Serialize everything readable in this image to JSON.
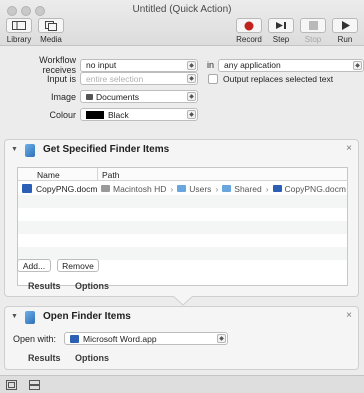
{
  "window": {
    "title": "Untitled (Quick Action)"
  },
  "toolbar": {
    "library_label": "Library",
    "media_label": "Media",
    "record_label": "Record",
    "step_label": "Step",
    "stop_label": "Stop",
    "run_label": "Run",
    "record_color": "#c0221c"
  },
  "workflow": {
    "receives_label": "Workflow receives",
    "receives_value": "no input",
    "in_label": "in",
    "in_value": "any application",
    "input_is_label": "Input is",
    "input_is_value": "entire selection",
    "replaces_label": "Output replaces selected text",
    "image_label": "Image",
    "image_value": "Documents",
    "colour_label": "Colour",
    "colour_value": "Black",
    "colour_swatch": "#000000"
  },
  "action1": {
    "title": "Get Specified Finder Items",
    "col_name": "Name",
    "col_path": "Path",
    "file_name": "CopyPNG.docm",
    "path": [
      "Macintosh HD",
      "Users",
      "Shared",
      "CopyPNG.docm"
    ],
    "add_label": "Add...",
    "remove_label": "Remove",
    "results_tab": "Results",
    "options_tab": "Options"
  },
  "action2": {
    "title": "Open Finder Items",
    "open_with_label": "Open with:",
    "open_with_value": "Microsoft Word.app",
    "results_tab": "Results",
    "options_tab": "Options"
  },
  "close_glyph": "×",
  "disclosure_glyph": "▼",
  "chevron_glyph": "⌃"
}
